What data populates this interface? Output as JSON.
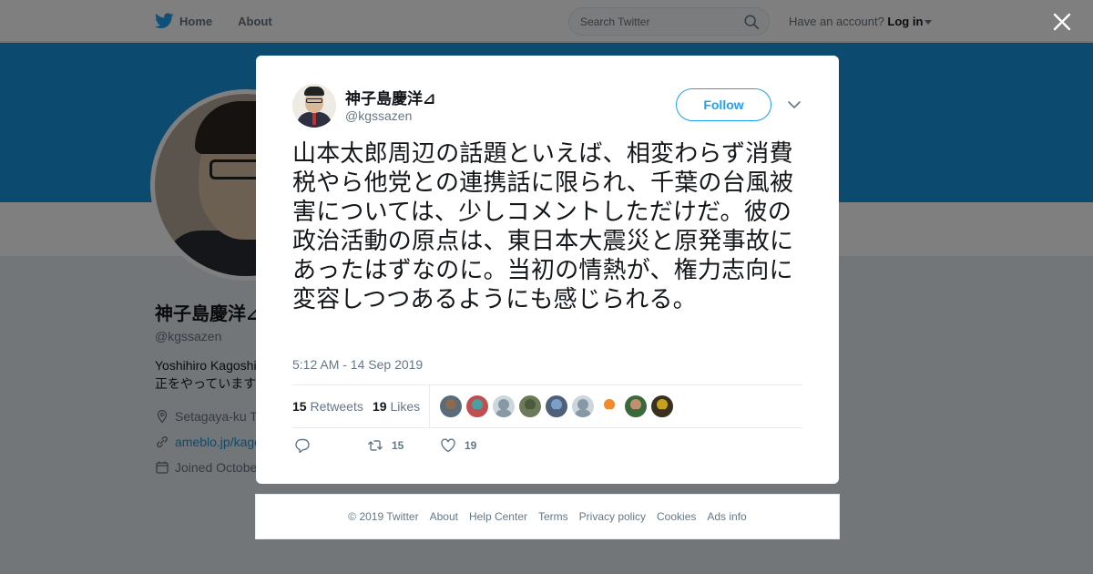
{
  "topbar": {
    "home_label": "Home",
    "about_label": "About",
    "search_placeholder": "Search Twitter",
    "account_prompt": "Have an account?",
    "login_label": "Log in"
  },
  "profile": {
    "name": "神子島慶洋⊿",
    "handle": "@kgssazen",
    "bio_line1": "Yoshihiro Kagoshi",
    "bio_line2": "正をやっています",
    "location": "Setagaya-ku T",
    "website": "ameblo.jp/kago",
    "joined": "Joined Octobe"
  },
  "tweet": {
    "author_name": "神子島慶洋⊿",
    "author_handle": "@kgssazen",
    "follow_label": "Follow",
    "text": "山本太郎周辺の話題といえば、相変わらず消費税やら他党との連携話に限られ、千葉の台風被害については、少しコメントしただけだ。彼の政治活動の原点は、東日本大震災と原発事故にあったはずなのに。当初の情熱が、権力志向に変容しつつあるようにも感じられる。",
    "timestamp": "5:12 AM - 14 Sep 2019",
    "retweets_count": "15",
    "retweets_label": "Retweets",
    "likes_count": "19",
    "likes_label": "Likes",
    "actions": {
      "retweet_count": "15",
      "like_count": "19"
    },
    "likers": [
      {
        "top": "#8a6a50",
        "bottom": "#5a6b7a"
      },
      {
        "top": "#4aa0a0",
        "bottom": "#c05050"
      },
      {
        "top": "#aab8c2",
        "bottom": "#aab8c2"
      },
      {
        "top": "#4b5a3a",
        "bottom": "#6c7a5a"
      },
      {
        "top": "#7aa0c8",
        "bottom": "#50607a"
      },
      {
        "top": "#aab8c2",
        "bottom": "#aab8c2"
      },
      {
        "top": "#f08a2a",
        "bottom": "#ffffff"
      },
      {
        "top": "#c09070",
        "bottom": "#3a6a3a"
      },
      {
        "top": "#c8a020",
        "bottom": "#3a3020"
      }
    ]
  },
  "footer": {
    "links": [
      "© 2019 Twitter",
      "About",
      "Help Center",
      "Terms",
      "Privacy policy",
      "Cookies",
      "Ads info"
    ]
  },
  "colors": {
    "twitter_blue": "#1da1f2",
    "banner": "#1b95e0",
    "overlay": "rgba(0,0,0,0.5)"
  },
  "icons": {
    "logo": "twitter-bird-icon",
    "search": "search-icon",
    "close": "close-icon",
    "dropdown": "chevron-down-icon",
    "reply": "reply-icon",
    "retweet": "retweet-icon",
    "like": "heart-icon"
  }
}
